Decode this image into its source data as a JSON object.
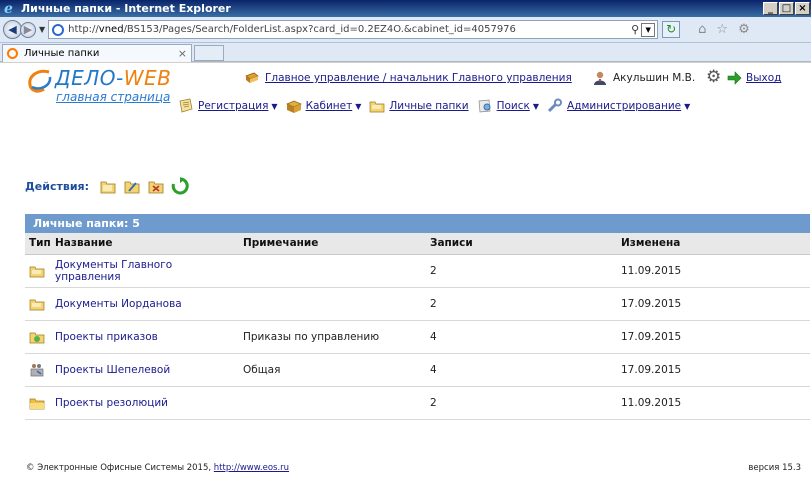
{
  "window": {
    "title": "Личные папки - Internet Explorer",
    "min": "_",
    "max": "□",
    "close": "×"
  },
  "address": {
    "url_prefix": "http://",
    "url_host": "vned",
    "url_rest": "/BS153/Pages/Search/FolderList.aspx?card_id=0.2EZ4O.&cabinet_id=4057976"
  },
  "tab": {
    "label": "Личные папки",
    "close": "×"
  },
  "logo": {
    "brand_a": "ДЕЛО-",
    "brand_b": "WEB",
    "sub": "главная страница"
  },
  "header": {
    "dept": "Главное управление / начальник Главного управления",
    "user": "Акульшин М.В.",
    "logout": "Выход"
  },
  "menu": [
    {
      "label": "Регистрация",
      "dropdown": true,
      "icon": "register-icon"
    },
    {
      "label": "Кабинет",
      "dropdown": true,
      "icon": "cabinet-icon"
    },
    {
      "label": "Личные папки",
      "dropdown": false,
      "icon": "folders-icon"
    },
    {
      "label": "Поиск",
      "dropdown": true,
      "icon": "search-icon"
    },
    {
      "label": "Администрирование",
      "dropdown": true,
      "icon": "admin-icon"
    }
  ],
  "actions": {
    "label": "Действия:"
  },
  "grid": {
    "title": "Личные папки: 5",
    "columns": [
      "Тип",
      "Название",
      "Примечание",
      "Записи",
      "Изменена"
    ],
    "rows": [
      {
        "icon": "folder-icon",
        "name": "Документы Главного управления",
        "note": "",
        "records": "2",
        "changed": "11.09.2015"
      },
      {
        "icon": "folder-icon",
        "name": "Документы Иорданова",
        "note": "",
        "records": "2",
        "changed": "17.09.2015"
      },
      {
        "icon": "folder-green-icon",
        "name": "Проекты приказов",
        "note": "Приказы по управлению",
        "records": "4",
        "changed": "17.09.2015"
      },
      {
        "icon": "shared-folder-icon",
        "name": "Проекты Шепелевой",
        "note": "Общая",
        "records": "4",
        "changed": "17.09.2015"
      },
      {
        "icon": "folder-yellow-icon",
        "name": "Проекты резолюций",
        "note": "",
        "records": "2",
        "changed": "11.09.2015"
      }
    ]
  },
  "footer": {
    "text": "© Электронные Офисные Системы 2015, ",
    "link": "http://www.eos.ru",
    "version": "версия 15.3"
  }
}
